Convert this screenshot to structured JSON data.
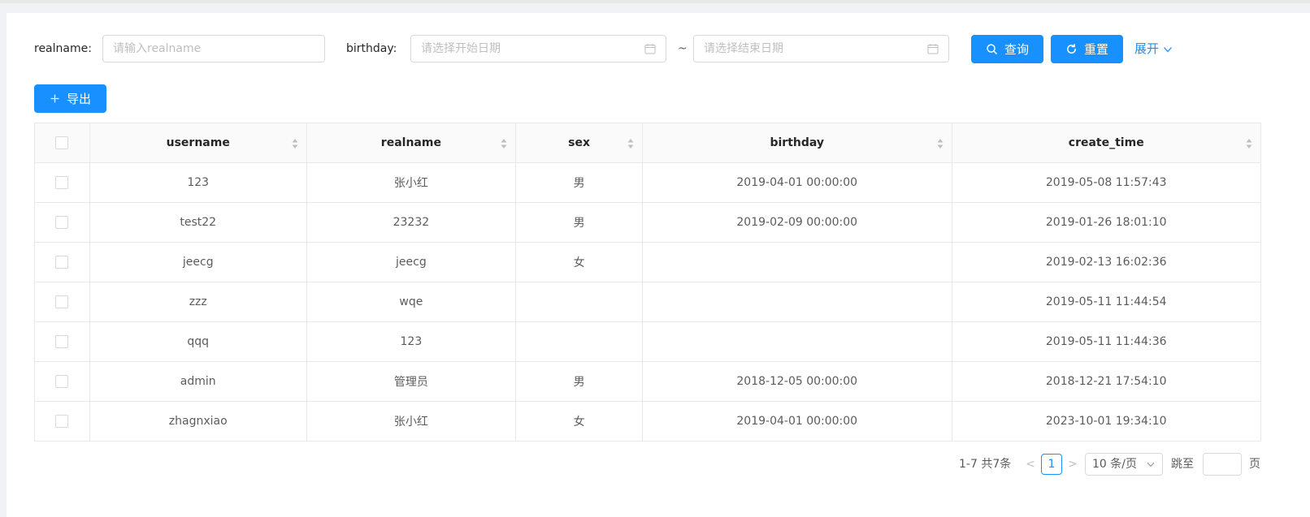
{
  "search": {
    "realname_label": "realname:",
    "realname_placeholder": "请输入realname",
    "birthday_label": "birthday:",
    "start_placeholder": "请选择开始日期",
    "separator": "~",
    "end_placeholder": "请选择结束日期",
    "query_label": "查询",
    "reset_label": "重置",
    "expand_label": "展开"
  },
  "toolbar": {
    "export_label": "导出"
  },
  "table": {
    "columns": [
      "username",
      "realname",
      "sex",
      "birthday",
      "create_time"
    ],
    "rows": [
      [
        "123",
        "张小红",
        "男",
        "2019-04-01 00:00:00",
        "2019-05-08 11:57:43"
      ],
      [
        "test22",
        "23232",
        "男",
        "2019-02-09 00:00:00",
        "2019-01-26 18:01:10"
      ],
      [
        "jeecg",
        "jeecg",
        "女",
        "",
        "2019-02-13 16:02:36"
      ],
      [
        "zzz",
        "wqe",
        "",
        "",
        "2019-05-11 11:44:54"
      ],
      [
        "qqq",
        "123",
        "",
        "",
        "2019-05-11 11:44:36"
      ],
      [
        "admin",
        "管理员",
        "男",
        "2018-12-05 00:00:00",
        "2018-12-21 17:54:10"
      ],
      [
        "zhagnxiao",
        "张小红",
        "女",
        "2019-04-01 00:00:00",
        "2023-10-01 19:34:10"
      ]
    ]
  },
  "pagination": {
    "total_text": "1-7 共7条",
    "prev": "<",
    "current_page": "1",
    "next": ">",
    "page_size": "10 条/页",
    "jump_label": "跳至",
    "page_suffix": "页"
  },
  "colors": {
    "primary": "#1890ff",
    "border": "#e8e8e8",
    "header_bg": "#fafafa"
  },
  "icons": [
    "calendar-icon",
    "search-icon",
    "reload-icon",
    "plus-icon",
    "chevron-down-icon",
    "sort-icon"
  ]
}
